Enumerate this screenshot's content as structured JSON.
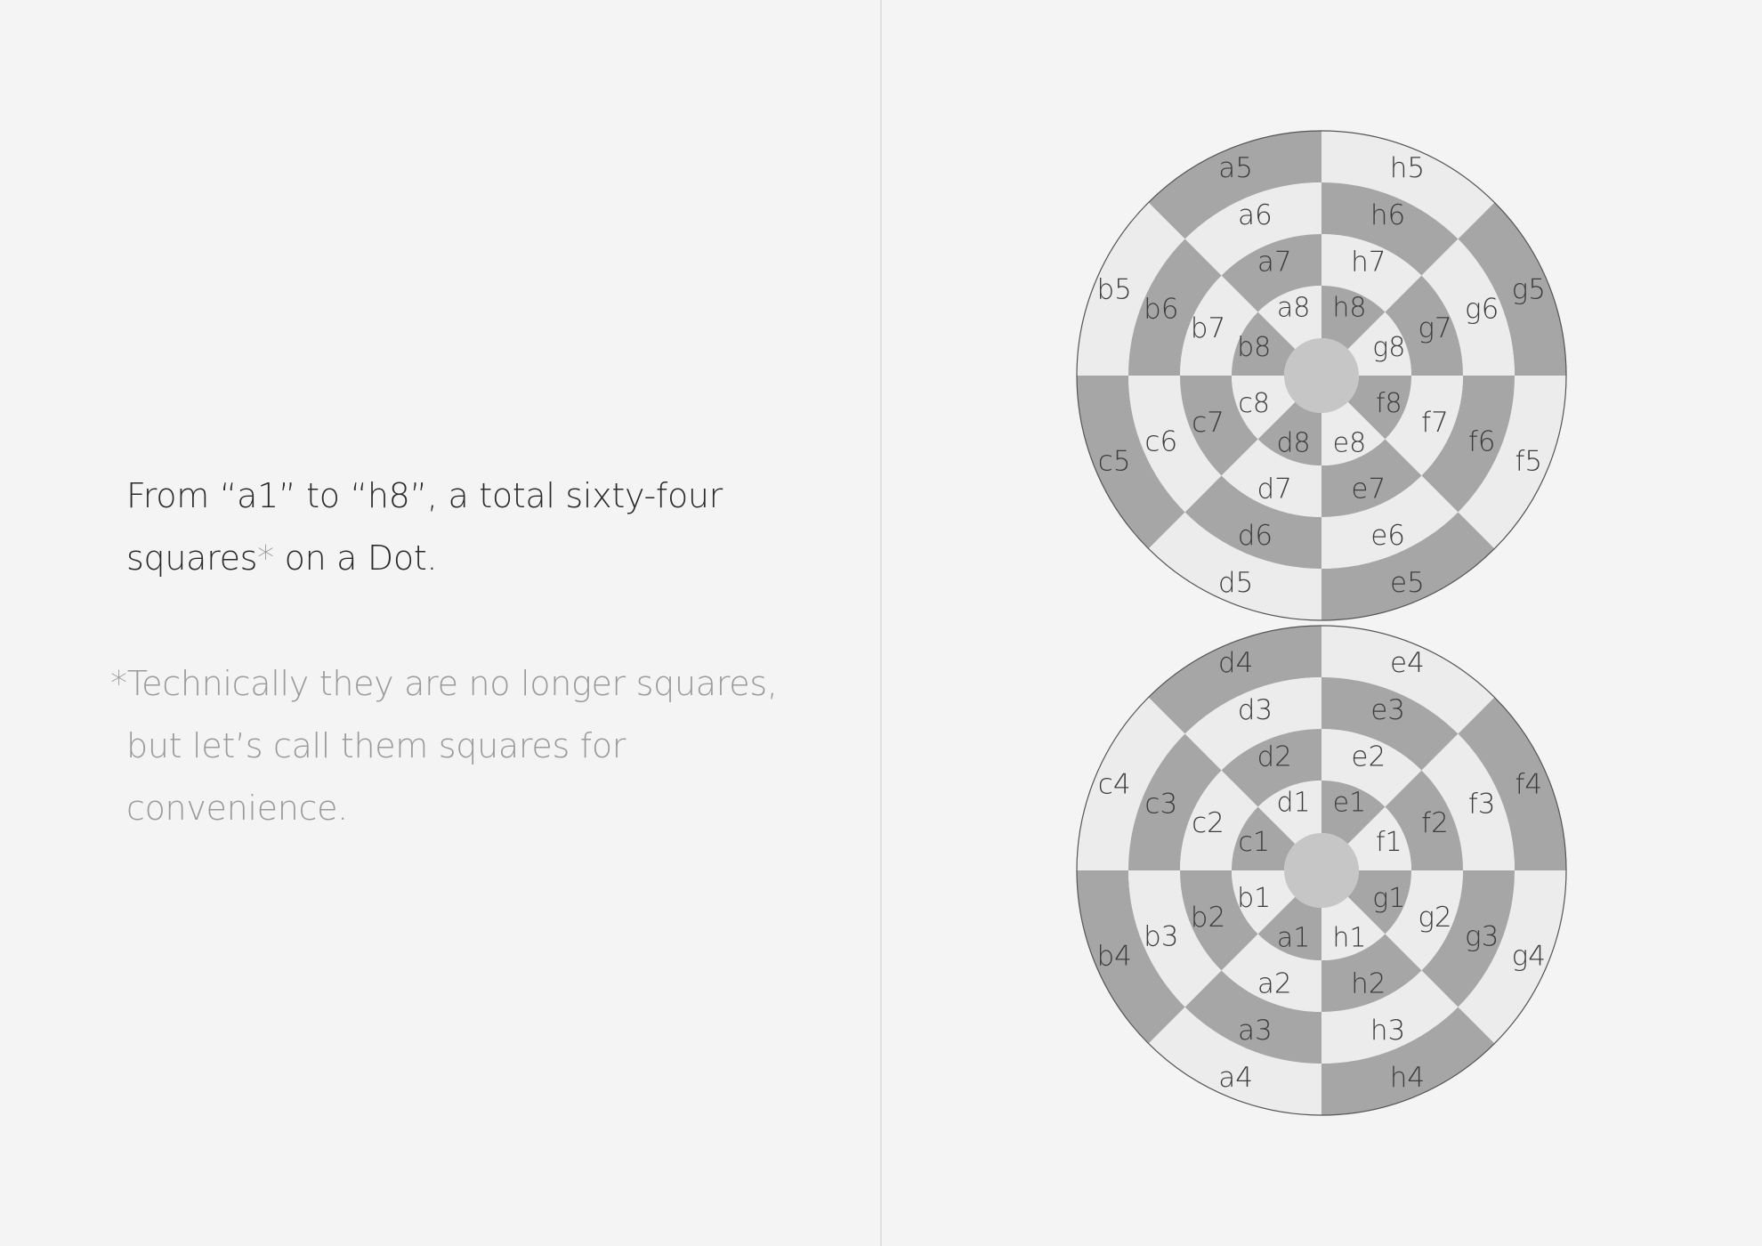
{
  "caption": {
    "main_prefix": "From “a1” to “h8”, a total sixty-four",
    "main_line2_word": "squares",
    "main_asterisk": "*",
    "main_line2_rest": " on a Dot.",
    "footnote_line1": "*Technically they are no longer squares,",
    "footnote_line2": "but let’s call them squares for convenience."
  },
  "colors": {
    "background": "#f4f4f4",
    "dark_square": "#a6a6a6",
    "light_square": "#ececec",
    "center_dot": "#c6c6c6",
    "outline": "#555555",
    "label": "#3c3c3c"
  },
  "board": {
    "top_disc": {
      "rings": [
        [
          "a5",
          "h5",
          "g5",
          "f5",
          "e5",
          "d5",
          "c5",
          "b5"
        ],
        [
          "a6",
          "h6",
          "g6",
          "f6",
          "e6",
          "d6",
          "c6",
          "b6"
        ],
        [
          "a7",
          "h7",
          "g7",
          "f7",
          "e7",
          "d7",
          "c7",
          "b7"
        ],
        [
          "a8",
          "h8",
          "g8",
          "f8",
          "e8",
          "d8",
          "c8",
          "b8"
        ]
      ],
      "dark_parity": 0
    },
    "bottom_disc": {
      "rings": [
        [
          "d4",
          "e4",
          "f4",
          "g4",
          "h4",
          "a4",
          "b4",
          "c4"
        ],
        [
          "d3",
          "e3",
          "f3",
          "g3",
          "h3",
          "a3",
          "b3",
          "c3"
        ],
        [
          "d2",
          "e2",
          "f2",
          "g2",
          "h2",
          "a2",
          "b2",
          "c2"
        ],
        [
          "d1",
          "e1",
          "f1",
          "g1",
          "h1",
          "a1",
          "b1",
          "c1"
        ]
      ],
      "dark_parity": 0
    }
  }
}
